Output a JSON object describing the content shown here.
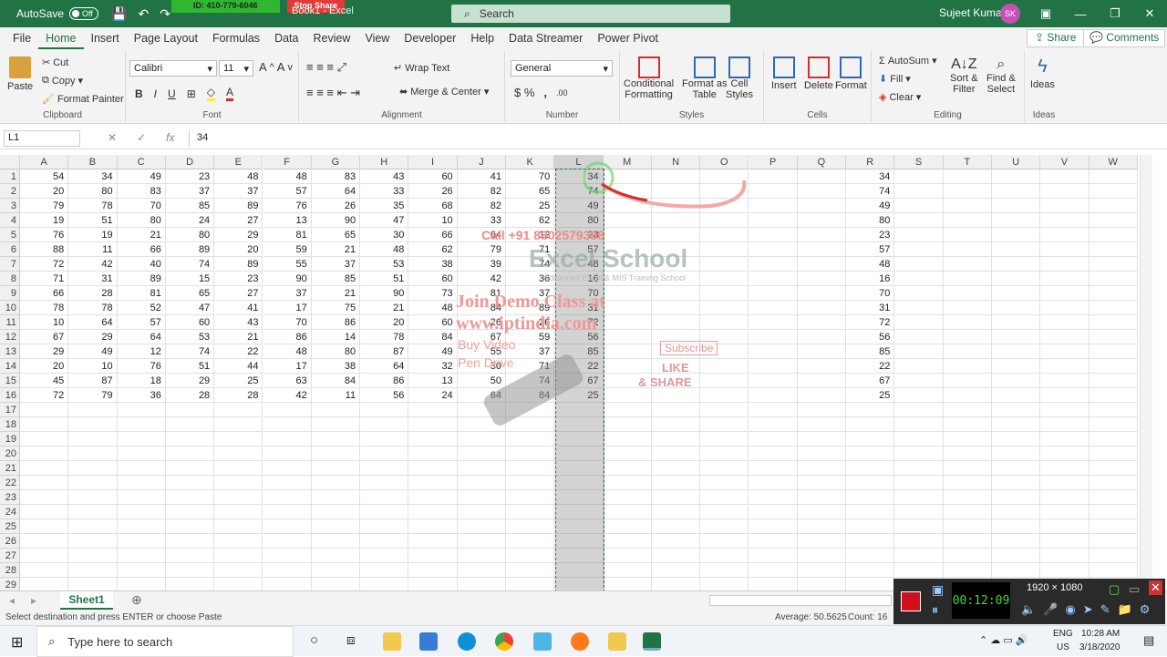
{
  "titlebar": {
    "autosave_label": "AutoSave",
    "autosave_state": "Off",
    "doc_title": "Book1 - Excel",
    "search_placeholder": "Search",
    "user_name": "Sujeet Kumar",
    "user_initials": "SK",
    "share_session_id": "ID: 410-779-6046",
    "stop_share_label": "Stop Share"
  },
  "tabs": [
    "File",
    "Home",
    "Insert",
    "Page Layout",
    "Formulas",
    "Data",
    "Review",
    "View",
    "Developer",
    "Help",
    "Data Streamer",
    "Power Pivot"
  ],
  "active_tab": "Home",
  "share_label": "Share",
  "comments_label": "Comments",
  "ribbon": {
    "clipboard": {
      "paste": "Paste",
      "cut": "Cut",
      "copy": "Copy",
      "format_painter": "Format Painter",
      "label": "Clipboard"
    },
    "font": {
      "family": "Calibri",
      "size": "11",
      "label": "Font"
    },
    "alignment": {
      "wrap_text": "Wrap Text",
      "merge_center": "Merge & Center",
      "label": "Alignment"
    },
    "number": {
      "format": "General",
      "label": "Number"
    },
    "styles": {
      "conditional": "Conditional",
      "conditional2": "Formatting",
      "format_as": "Format as",
      "table": "Table",
      "cell": "Cell",
      "styles_word": "Styles",
      "label": "Styles"
    },
    "cells": {
      "insert": "Insert",
      "delete": "Delete",
      "format": "Format",
      "label": "Cells"
    },
    "editing": {
      "autosum": "AutoSum",
      "fill": "Fill",
      "clear": "Clear",
      "sort": "Sort &",
      "filter": "Filter",
      "find": "Find &",
      "select": "Select",
      "label": "Editing"
    },
    "ideas": {
      "ideas": "Ideas",
      "label": "Ideas"
    }
  },
  "formula_bar": {
    "name_box": "L1",
    "value": "34"
  },
  "columns": [
    "A",
    "B",
    "C",
    "D",
    "E",
    "F",
    "G",
    "H",
    "I",
    "J",
    "K",
    "L",
    "M",
    "N",
    "O",
    "P",
    "Q",
    "R",
    "S",
    "T",
    "U",
    "V",
    "W"
  ],
  "rows": [
    "1",
    "2",
    "3",
    "4",
    "5",
    "6",
    "7",
    "8",
    "9",
    "10",
    "11",
    "12",
    "13",
    "14",
    "15",
    "16",
    "17",
    "18",
    "19",
    "20",
    "21",
    "22",
    "23",
    "24",
    "25",
    "26",
    "27",
    "28",
    "29"
  ],
  "cells": [
    [
      "54",
      "34",
      "49",
      "23",
      "48",
      "48",
      "83",
      "43",
      "60",
      "41",
      "70",
      "34"
    ],
    [
      "20",
      "80",
      "83",
      "37",
      "37",
      "57",
      "64",
      "33",
      "26",
      "82",
      "65",
      "74"
    ],
    [
      "79",
      "78",
      "70",
      "85",
      "89",
      "76",
      "26",
      "35",
      "68",
      "82",
      "25",
      "49"
    ],
    [
      "19",
      "51",
      "80",
      "24",
      "27",
      "13",
      "90",
      "47",
      "10",
      "33",
      "62",
      "80"
    ],
    [
      "76",
      "19",
      "21",
      "80",
      "29",
      "81",
      "65",
      "30",
      "66",
      "64",
      "12",
      "23"
    ],
    [
      "88",
      "11",
      "66",
      "89",
      "20",
      "59",
      "21",
      "48",
      "62",
      "79",
      "71",
      "57"
    ],
    [
      "72",
      "42",
      "40",
      "74",
      "89",
      "55",
      "37",
      "53",
      "38",
      "39",
      "74",
      "48"
    ],
    [
      "71",
      "31",
      "89",
      "15",
      "23",
      "90",
      "85",
      "51",
      "60",
      "42",
      "36",
      "16"
    ],
    [
      "66",
      "28",
      "81",
      "65",
      "27",
      "37",
      "21",
      "90",
      "73",
      "81",
      "37",
      "70"
    ],
    [
      "78",
      "78",
      "52",
      "47",
      "41",
      "17",
      "75",
      "21",
      "48",
      "84",
      "89",
      "31"
    ],
    [
      "10",
      "64",
      "57",
      "60",
      "43",
      "70",
      "86",
      "20",
      "60",
      "26",
      "26",
      "72"
    ],
    [
      "67",
      "29",
      "64",
      "53",
      "21",
      "86",
      "14",
      "78",
      "84",
      "67",
      "59",
      "56"
    ],
    [
      "29",
      "49",
      "12",
      "74",
      "22",
      "48",
      "80",
      "87",
      "49",
      "55",
      "37",
      "85"
    ],
    [
      "20",
      "10",
      "76",
      "51",
      "44",
      "17",
      "38",
      "64",
      "32",
      "30",
      "71",
      "22"
    ],
    [
      "45",
      "87",
      "18",
      "29",
      "25",
      "63",
      "84",
      "86",
      "13",
      "50",
      "74",
      "67"
    ],
    [
      "72",
      "79",
      "36",
      "28",
      "28",
      "42",
      "11",
      "56",
      "24",
      "64",
      "84",
      "25"
    ]
  ],
  "col_r": [
    "34",
    "74",
    "49",
    "80",
    "23",
    "57",
    "48",
    "16",
    "70",
    "31",
    "72",
    "56",
    "85",
    "22",
    "67",
    "25"
  ],
  "sheet_tab": "Sheet1",
  "status": {
    "message": "Select destination and press ENTER or choose Paste",
    "average": "Average: 50.5625",
    "count": "Count: 16"
  },
  "taskbar": {
    "search_placeholder": "Type here to search",
    "lang": "ENG",
    "region": "US",
    "time": "10:28 AM",
    "date": "3/18/2020"
  },
  "recorder": {
    "timer": "00:12:09",
    "resolution": "1920 × 1080"
  },
  "watermark": {
    "phone": "Call +91 8802579388",
    "brand": "Excel School",
    "tagline": "Advanced Excel & MIS Training School",
    "demo": "Join Demo Class at",
    "site": "www.iptindia.com",
    "buy": "Buy Video",
    "pen": "Pen Drive",
    "subscribe": "Subscribe",
    "like": "LIKE",
    "share": "& SHARE"
  }
}
